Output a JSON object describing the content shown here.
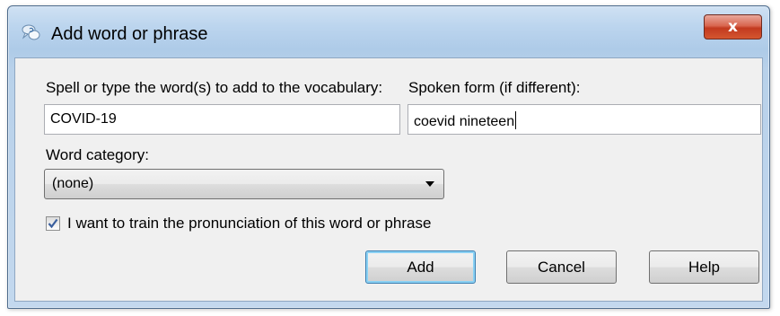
{
  "window": {
    "title": "Add word or phrase",
    "close_label": "x"
  },
  "form": {
    "spell_label": "Spell or type the word(s) to add to the vocabulary:",
    "spell_value": "COVID-19",
    "spoken_label": "Spoken form (if different):",
    "spoken_value": "coevid nineteen",
    "category_label": "Word category:",
    "category_value": "(none)",
    "train_label": "I want to train the pronunciation of this word or phrase",
    "train_checked": true
  },
  "buttons": {
    "add": "Add",
    "cancel": "Cancel",
    "help": "Help"
  },
  "icons": {
    "app": "dragon-speech-icon",
    "close": "close-icon",
    "dropdown": "chevron-down-icon",
    "check": "checkmark-icon"
  },
  "colors": {
    "close_red": "#c23a1f",
    "default_button_border": "#3c7fb1",
    "check_blue": "#3a5f9e"
  }
}
